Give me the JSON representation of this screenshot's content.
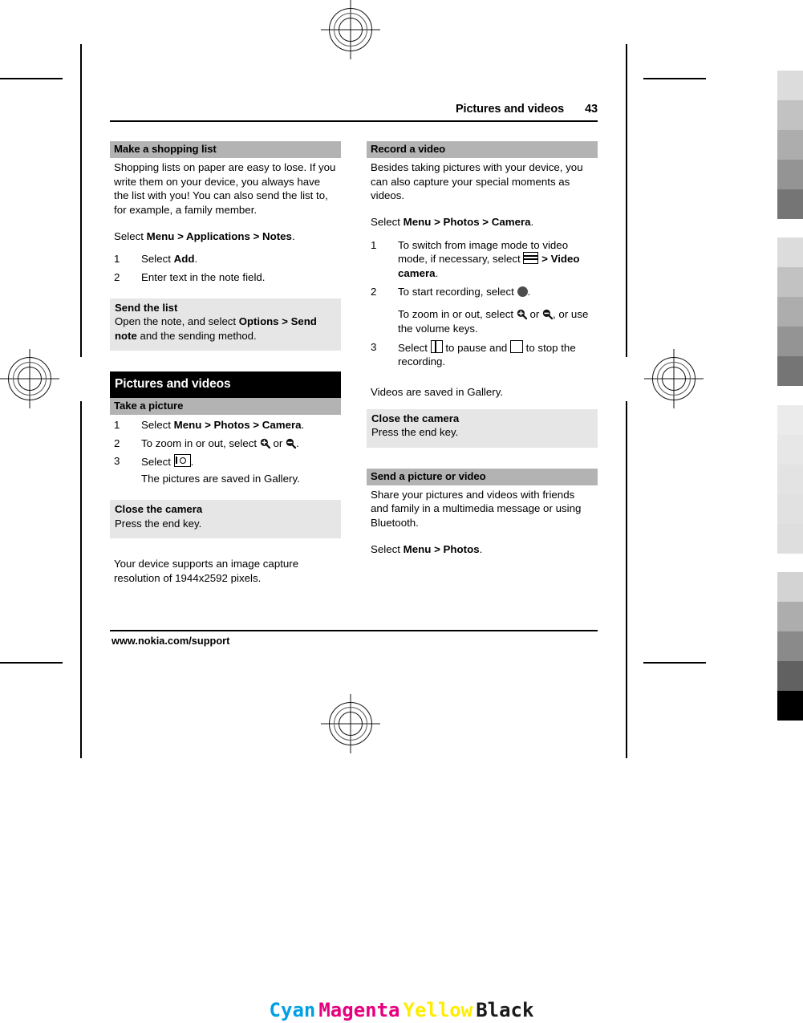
{
  "header": {
    "chapter_title": "Pictures and videos",
    "page_number": "43"
  },
  "footer": {
    "url": "www.nokia.com/support"
  },
  "left_column": {
    "section1": {
      "heading": "Make a shopping list",
      "body": "Shopping lists on paper are easy to lose. If you write them on your device, you always have the list with you! You can also send the list to, for example, a family member.",
      "select_prefix": "Select ",
      "select_menu": "Menu",
      "sep1": " > ",
      "select_applications": "Applications",
      "sep2": " > ",
      "select_notes": "Notes",
      "select_suffix": ".",
      "steps": [
        {
          "text_prefix": "Select ",
          "bold": "Add",
          "text_suffix": "."
        },
        {
          "text_prefix": "Enter text in the note field.",
          "bold": "",
          "text_suffix": ""
        }
      ]
    },
    "subsection_send_list": {
      "title": "Send the list",
      "body_prefix": "Open the note, and select ",
      "body_bold1": "Options",
      "body_mid": " > ",
      "body_bold2": "Send note",
      "body_suffix": " and the sending method."
    },
    "section2": {
      "heading": "Pictures and videos",
      "sub_heading": "Take a picture",
      "steps": [
        {
          "prefix": "Select ",
          "bold1": "Menu",
          "sep1": " > ",
          "bold2": "Photos",
          "sep2": " > ",
          "bold3": "Camera",
          "suffix": "."
        },
        {
          "prefix": "To zoom in or out, select ",
          "icon1": "zoom-in-icon",
          "mid": " or ",
          "icon2": "zoom-out-icon",
          "suffix": "."
        },
        {
          "prefix": "Select ",
          "icon1": "camera-shutter-icon",
          "suffix": ".",
          "sub": "The pictures are saved in Gallery."
        }
      ]
    },
    "subsection_close_camera": {
      "title": "Close the camera",
      "body": "Press the end key."
    },
    "note": "Your device supports an image capture resolution of 1944x2592 pixels."
  },
  "right_column": {
    "section1": {
      "heading": "Record a video",
      "body": "Besides taking pictures with your device, you can also capture your special moments as videos.",
      "select_prefix": "Select ",
      "select_menu": "Menu",
      "sep1": " > ",
      "select_photos": "Photos",
      "sep2": " > ",
      "select_camera": "Camera",
      "select_suffix": ".",
      "steps": [
        {
          "prefix": "To switch from image mode to video mode, if necessary, select ",
          "icon1": "menu-list-icon",
          "mid": " > ",
          "bold1": "Video camera",
          "suffix": "."
        },
        {
          "prefix": "To start recording, select ",
          "icon1": "record-dot-icon",
          "suffix": ".",
          "sub_prefix": "To zoom in or out, select ",
          "sub_icon1": "zoom-in-icon",
          "sub_mid": " or ",
          "sub_icon2": "zoom-out-icon",
          "sub_suffix": ", or use the volume keys."
        },
        {
          "prefix": "Select ",
          "icon1": "pause-icon",
          "mid": " to pause and ",
          "icon2": "stop-icon",
          "suffix": " to stop the recording."
        }
      ],
      "after_note": "Videos are saved in Gallery."
    },
    "subsection_close_camera": {
      "title": "Close the camera",
      "body": "Press the end key."
    },
    "section2": {
      "heading": "Send a picture or video",
      "body": "Share your pictures and videos with friends and family in a multimedia message or using Bluetooth.",
      "select_prefix": "Select ",
      "select_menu": "Menu",
      "sep1": " > ",
      "select_photos": "Photos",
      "select_suffix": "."
    }
  },
  "print_legend": {
    "cyan": "Cyan",
    "magenta": "Magenta",
    "yellow": "Yellow",
    "black": "Black"
  },
  "colors": {
    "cyan": "#00a0e3",
    "magenta": "#e6007e",
    "yellow": "#ffed00",
    "black": "#1a1a1a",
    "heading_gray": "#b3b3b3",
    "box_gray": "#e6e6e6",
    "heading_black": "#000000"
  },
  "gray_strips": {
    "group1": [
      "#dcdcdc",
      "#c2c2c2",
      "#adadad",
      "#949494",
      "#757575"
    ],
    "group2": [
      "#dcdcdc",
      "#c2c2c2",
      "#adadad",
      "#949494",
      "#757575"
    ],
    "group3": [
      "#ebebeb",
      "#e6e6e6",
      "#e2e2e2",
      "#e0e0e0",
      "#dedede"
    ],
    "group4": [
      "#d3d3d3",
      "#adadad",
      "#8a8a8a",
      "#616161",
      "#000000"
    ]
  }
}
